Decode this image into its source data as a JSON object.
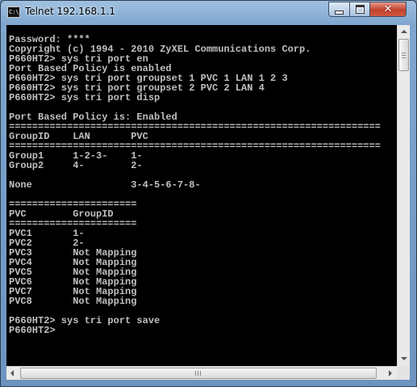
{
  "window": {
    "title": "Telnet 192.168.1.1",
    "icon_name": "console-icon",
    "icon_text": "C:\\",
    "close_glyph": "✕"
  },
  "console": {
    "lines": [
      "Password: ****",
      "Copyright (c) 1994 - 2010 ZyXEL Communications Corp.",
      "P660HT2> sys tri port en",
      "Port Based Policy is enabled",
      "P660HT2> sys tri port groupset 1 PVC 1 LAN 1 2 3",
      "P660HT2> sys tri port groupset 2 PVC 2 LAN 4",
      "P660HT2> sys tri port disp",
      "",
      "Port Based Policy is: Enabled",
      "================================================================",
      "GroupID    LAN       PVC",
      "================================================================",
      "Group1     1-2-3-    1-",
      "Group2     4-        2-",
      "",
      "None                 3-4-5-6-7-8-",
      "",
      "======================",
      "PVC        GroupID",
      "======================",
      "PVC1       1-",
      "PVC2       2-",
      "PVC3       Not Mapping",
      "PVC4       Not Mapping",
      "PVC5       Not Mapping",
      "PVC6       Not Mapping",
      "PVC7       Not Mapping",
      "PVC8       Not Mapping",
      "",
      "P660HT2> sys tri port save",
      "P660HT2>"
    ]
  },
  "colors": {
    "console_bg": "#000000",
    "console_fg": "#c0c0c0",
    "close_button": "#c2412d"
  }
}
